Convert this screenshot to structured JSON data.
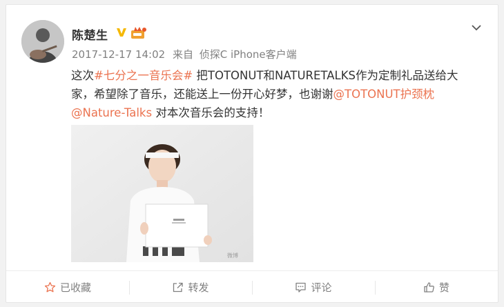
{
  "post": {
    "author": "陈楚生",
    "verified_icon": "verified-v-icon",
    "level_icon": "member-level-icon",
    "time": "2017-12-17 14:02",
    "source_prefix": "来自",
    "source": "侦探C iPhone客户端",
    "content": {
      "l1_a": "这次",
      "l1_tag": "#七分之一音乐会#",
      "l1_b": " 把TOTONUT和NATURETALKS作为定制礼品送给大",
      "l2_a": "家，希望除了音乐，还能送上一份开心好梦，也谢谢",
      "l2_mention": "@TOTONUT护颈枕",
      "l3_mention": "@Nature-Talks",
      "l3_b": " 对本次音乐会的支持！"
    },
    "image_watermark": "微博"
  },
  "actions": {
    "favorite": "已收藏",
    "repost": "转发",
    "comment": "评论",
    "like": "赞"
  },
  "colors": {
    "link": "#eb7350",
    "meta": "#808080",
    "badge": "#f5a623"
  }
}
